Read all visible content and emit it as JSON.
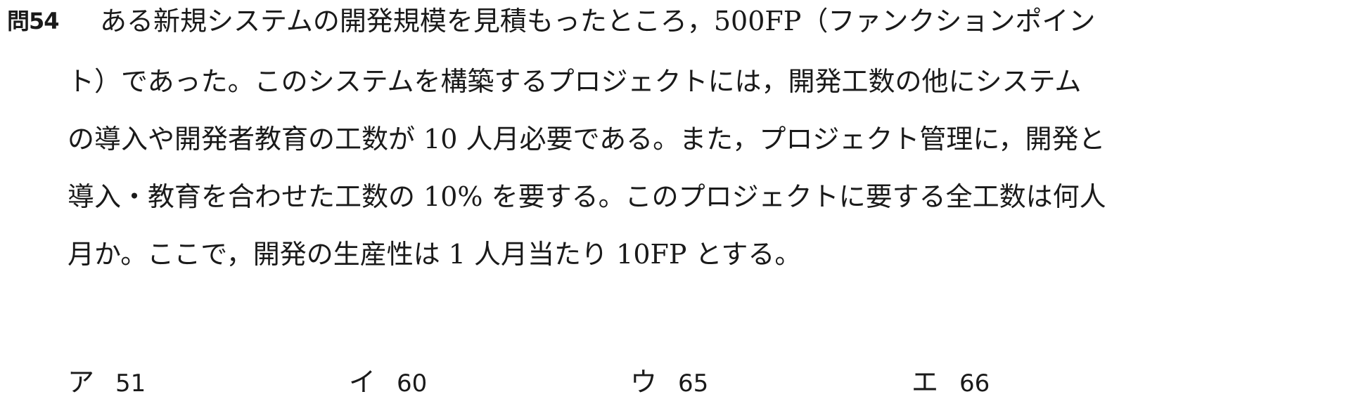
{
  "question": {
    "number": "問54",
    "lines": [
      "ある新規システムの開発規模を見積もったところ，500FP（ファンクションポイン",
      "ト）であった。このシステムを構築するプロジェクトには，開発工数の他にシステム",
      "の導入や開発者教育の工数が 10 人月必要である。また，プロジェクト管理に，開発と",
      "導入・教育を合わせた工数の 10% を要する。このプロジェクトに要する全工数は何人",
      "月か。ここで，開発の生産性は 1 人月当たり 10FP とする。"
    ]
  },
  "choices": [
    {
      "label": "ア",
      "value": "51"
    },
    {
      "label": "イ",
      "value": "60"
    },
    {
      "label": "ウ",
      "value": "65"
    },
    {
      "label": "エ",
      "value": "66"
    }
  ]
}
